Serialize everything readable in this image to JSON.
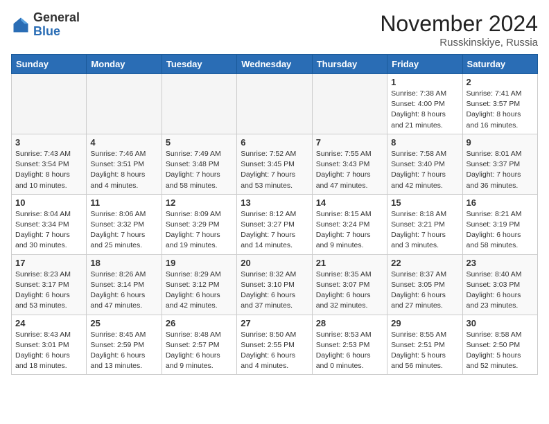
{
  "header": {
    "logo_general": "General",
    "logo_blue": "Blue",
    "month_title": "November 2024",
    "location": "Russkinskiye, Russia"
  },
  "weekdays": [
    "Sunday",
    "Monday",
    "Tuesday",
    "Wednesday",
    "Thursday",
    "Friday",
    "Saturday"
  ],
  "weeks": [
    [
      {
        "day": "",
        "info": ""
      },
      {
        "day": "",
        "info": ""
      },
      {
        "day": "",
        "info": ""
      },
      {
        "day": "",
        "info": ""
      },
      {
        "day": "",
        "info": ""
      },
      {
        "day": "1",
        "info": "Sunrise: 7:38 AM\nSunset: 4:00 PM\nDaylight: 8 hours\nand 21 minutes."
      },
      {
        "day": "2",
        "info": "Sunrise: 7:41 AM\nSunset: 3:57 PM\nDaylight: 8 hours\nand 16 minutes."
      }
    ],
    [
      {
        "day": "3",
        "info": "Sunrise: 7:43 AM\nSunset: 3:54 PM\nDaylight: 8 hours\nand 10 minutes."
      },
      {
        "day": "4",
        "info": "Sunrise: 7:46 AM\nSunset: 3:51 PM\nDaylight: 8 hours\nand 4 minutes."
      },
      {
        "day": "5",
        "info": "Sunrise: 7:49 AM\nSunset: 3:48 PM\nDaylight: 7 hours\nand 58 minutes."
      },
      {
        "day": "6",
        "info": "Sunrise: 7:52 AM\nSunset: 3:45 PM\nDaylight: 7 hours\nand 53 minutes."
      },
      {
        "day": "7",
        "info": "Sunrise: 7:55 AM\nSunset: 3:43 PM\nDaylight: 7 hours\nand 47 minutes."
      },
      {
        "day": "8",
        "info": "Sunrise: 7:58 AM\nSunset: 3:40 PM\nDaylight: 7 hours\nand 42 minutes."
      },
      {
        "day": "9",
        "info": "Sunrise: 8:01 AM\nSunset: 3:37 PM\nDaylight: 7 hours\nand 36 minutes."
      }
    ],
    [
      {
        "day": "10",
        "info": "Sunrise: 8:04 AM\nSunset: 3:34 PM\nDaylight: 7 hours\nand 30 minutes."
      },
      {
        "day": "11",
        "info": "Sunrise: 8:06 AM\nSunset: 3:32 PM\nDaylight: 7 hours\nand 25 minutes."
      },
      {
        "day": "12",
        "info": "Sunrise: 8:09 AM\nSunset: 3:29 PM\nDaylight: 7 hours\nand 19 minutes."
      },
      {
        "day": "13",
        "info": "Sunrise: 8:12 AM\nSunset: 3:27 PM\nDaylight: 7 hours\nand 14 minutes."
      },
      {
        "day": "14",
        "info": "Sunrise: 8:15 AM\nSunset: 3:24 PM\nDaylight: 7 hours\nand 9 minutes."
      },
      {
        "day": "15",
        "info": "Sunrise: 8:18 AM\nSunset: 3:21 PM\nDaylight: 7 hours\nand 3 minutes."
      },
      {
        "day": "16",
        "info": "Sunrise: 8:21 AM\nSunset: 3:19 PM\nDaylight: 6 hours\nand 58 minutes."
      }
    ],
    [
      {
        "day": "17",
        "info": "Sunrise: 8:23 AM\nSunset: 3:17 PM\nDaylight: 6 hours\nand 53 minutes."
      },
      {
        "day": "18",
        "info": "Sunrise: 8:26 AM\nSunset: 3:14 PM\nDaylight: 6 hours\nand 47 minutes."
      },
      {
        "day": "19",
        "info": "Sunrise: 8:29 AM\nSunset: 3:12 PM\nDaylight: 6 hours\nand 42 minutes."
      },
      {
        "day": "20",
        "info": "Sunrise: 8:32 AM\nSunset: 3:10 PM\nDaylight: 6 hours\nand 37 minutes."
      },
      {
        "day": "21",
        "info": "Sunrise: 8:35 AM\nSunset: 3:07 PM\nDaylight: 6 hours\nand 32 minutes."
      },
      {
        "day": "22",
        "info": "Sunrise: 8:37 AM\nSunset: 3:05 PM\nDaylight: 6 hours\nand 27 minutes."
      },
      {
        "day": "23",
        "info": "Sunrise: 8:40 AM\nSunset: 3:03 PM\nDaylight: 6 hours\nand 23 minutes."
      }
    ],
    [
      {
        "day": "24",
        "info": "Sunrise: 8:43 AM\nSunset: 3:01 PM\nDaylight: 6 hours\nand 18 minutes."
      },
      {
        "day": "25",
        "info": "Sunrise: 8:45 AM\nSunset: 2:59 PM\nDaylight: 6 hours\nand 13 minutes."
      },
      {
        "day": "26",
        "info": "Sunrise: 8:48 AM\nSunset: 2:57 PM\nDaylight: 6 hours\nand 9 minutes."
      },
      {
        "day": "27",
        "info": "Sunrise: 8:50 AM\nSunset: 2:55 PM\nDaylight: 6 hours\nand 4 minutes."
      },
      {
        "day": "28",
        "info": "Sunrise: 8:53 AM\nSunset: 2:53 PM\nDaylight: 6 hours\nand 0 minutes."
      },
      {
        "day": "29",
        "info": "Sunrise: 8:55 AM\nSunset: 2:51 PM\nDaylight: 5 hours\nand 56 minutes."
      },
      {
        "day": "30",
        "info": "Sunrise: 8:58 AM\nSunset: 2:50 PM\nDaylight: 5 hours\nand 52 minutes."
      }
    ]
  ]
}
